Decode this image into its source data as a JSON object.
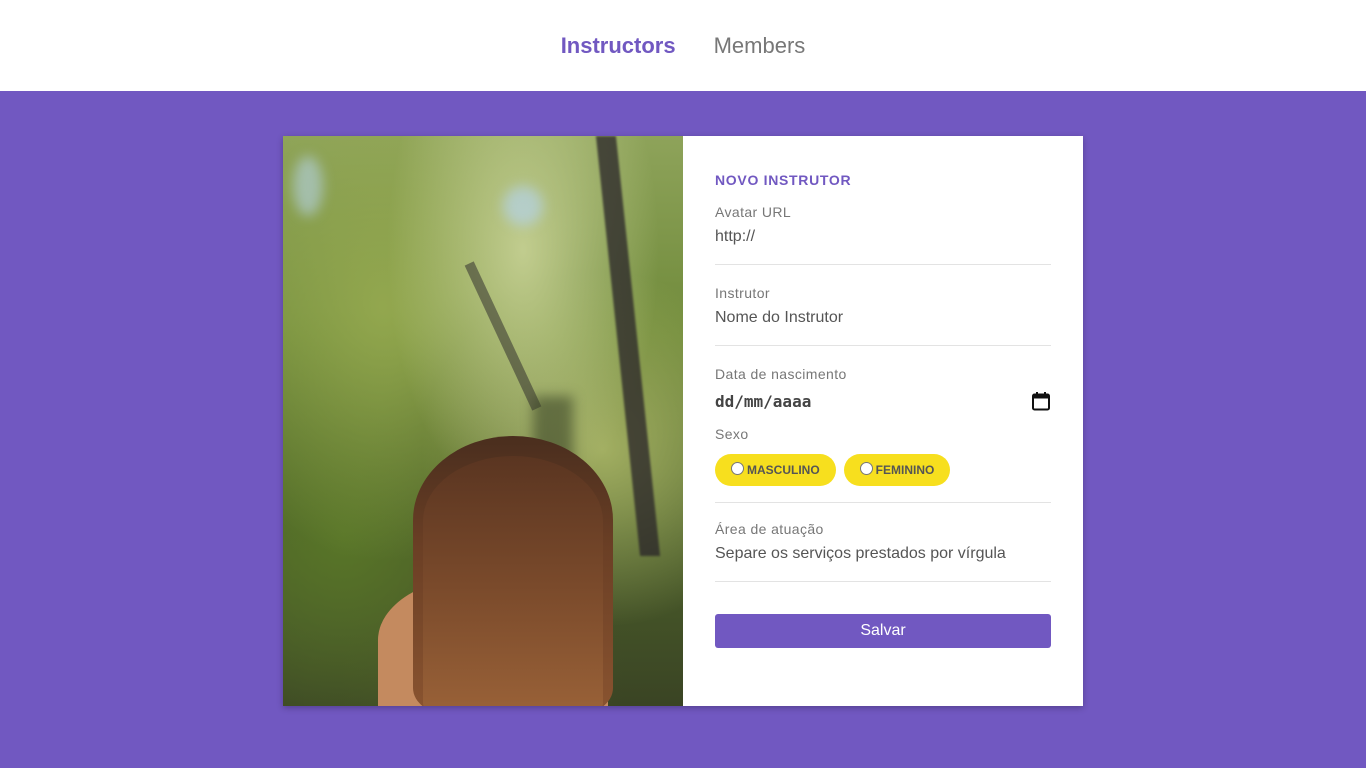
{
  "nav": {
    "items": [
      {
        "label": "Instructors",
        "active": true
      },
      {
        "label": "Members",
        "active": false
      }
    ]
  },
  "colors": {
    "accent": "#7158c1",
    "pill": "#f7df1e",
    "background": "#7158c1"
  },
  "form": {
    "title": "NOVO INSTRUTOR",
    "avatar": {
      "label": "Avatar URL",
      "placeholder": "http://",
      "value": ""
    },
    "name": {
      "label": "Instrutor",
      "placeholder": "Nome do Instrutor",
      "value": ""
    },
    "birth": {
      "label": "Data de nascimento",
      "placeholder": "dd/mm/aaaa",
      "icon": "calendar-icon"
    },
    "gender": {
      "label": "Sexo",
      "options": [
        {
          "label": "MASCULINO",
          "checked": false
        },
        {
          "label": "FEMININO",
          "checked": false
        }
      ]
    },
    "area": {
      "label": "Área de atuação",
      "placeholder": "Separe os serviços prestados por vírgula",
      "value": ""
    },
    "submit_label": "Salvar"
  },
  "image": {
    "description_icon": "photo-woman-forest"
  }
}
